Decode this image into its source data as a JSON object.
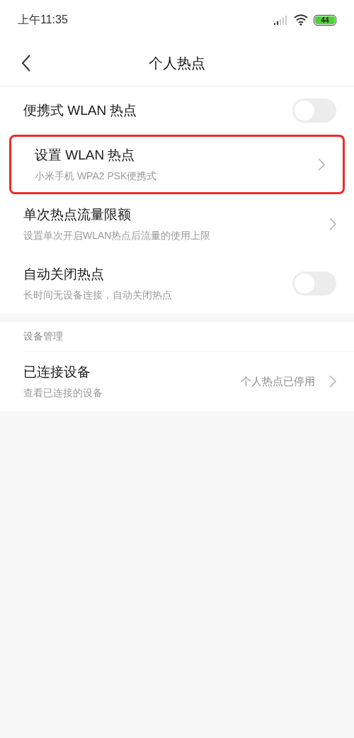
{
  "status_bar": {
    "time": "上午11:35",
    "battery": "44"
  },
  "header": {
    "title": "个人热点"
  },
  "sections": [
    {
      "items": [
        {
          "kind": "toggle",
          "title": "便携式 WLAN 热点",
          "on": false,
          "highlighted": false
        },
        {
          "kind": "link",
          "title": "设置 WLAN 热点",
          "subtitle": "小米手机 WPA2 PSK便携式",
          "highlighted": true
        },
        {
          "kind": "link",
          "title": "单次热点流量限额",
          "subtitle": "设置单次开启WLAN热点后流量的使用上限",
          "highlighted": false
        },
        {
          "kind": "toggle",
          "title": "自动关闭热点",
          "subtitle": "长时间无设备连接，自动关闭热点",
          "on": false,
          "highlighted": false
        }
      ]
    },
    {
      "header": "设备管理",
      "items": [
        {
          "kind": "link",
          "title": "已连接设备",
          "subtitle": "查看已连接的设备",
          "value": "个人热点已停用",
          "highlighted": false
        }
      ]
    }
  ]
}
